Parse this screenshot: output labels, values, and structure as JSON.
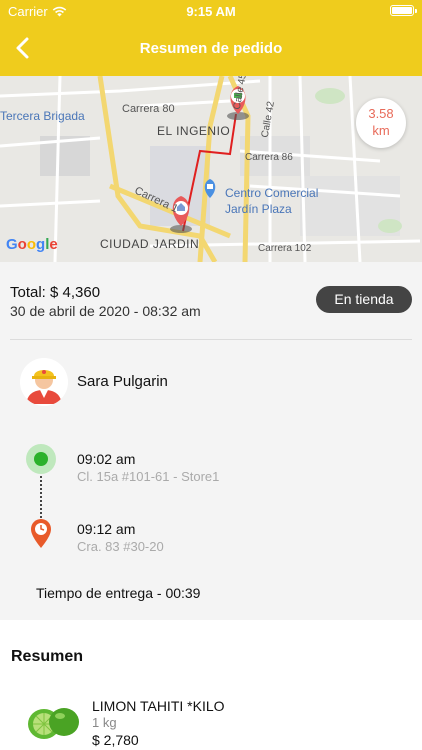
{
  "status_bar": {
    "carrier": "Carrier",
    "time": "9:15 AM"
  },
  "nav": {
    "title": "Resumen de pedido"
  },
  "map": {
    "streets": [
      "Carrera 80",
      "Calle 45",
      "Calle 42",
      "Carrera 86",
      "Carrera 102",
      "Carrera 1"
    ],
    "places": [
      "Tercera Brigada",
      "EL INGENIO",
      "CIUDAD JARDIN",
      "Centro Comercial",
      "Jardín Plaza"
    ],
    "logo": "Google",
    "distance_value": "3.58",
    "distance_unit": "km"
  },
  "order": {
    "total": "Total: $ 4,360",
    "date": "30 de abril de 2020 - 08:32 am",
    "status": "En tienda"
  },
  "courier": {
    "name": "Sara Pulgarin"
  },
  "timeline": {
    "start_time": "09:02 am",
    "start_address": "Cl. 15a #101-61 - Store1",
    "end_time": "09:12 am",
    "end_address": "Cra. 83 #30-20",
    "delivery_time": "Tiempo de entrega - 00:39"
  },
  "summary": {
    "title": "Resumen",
    "items": [
      {
        "name": "LIMON TAHITI *KILO",
        "qty": "1 kg",
        "price": "$ 2,780"
      }
    ]
  },
  "colors": {
    "header": "#efcc1d",
    "route": "#e02020",
    "status_pill": "#444444",
    "distance": "#e86b5a"
  }
}
